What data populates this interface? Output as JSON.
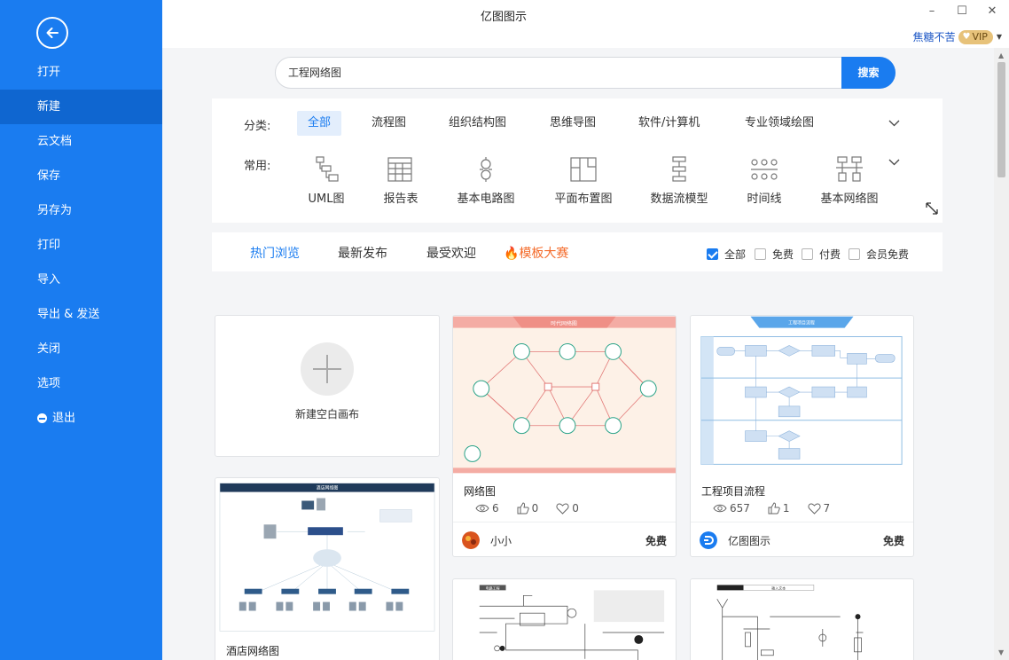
{
  "app": {
    "title": "亿图图示"
  },
  "window": {
    "minimize": "–",
    "maximize": "☐",
    "close": "✕"
  },
  "user": {
    "name": "焦糖不苦",
    "vip": "VIP"
  },
  "sidebar": {
    "items": [
      {
        "label": "打开"
      },
      {
        "label": "新建",
        "active": true
      },
      {
        "label": "云文档"
      },
      {
        "label": "保存"
      },
      {
        "label": "另存为"
      },
      {
        "label": "打印"
      },
      {
        "label": "导入"
      },
      {
        "label": "导出 & 发送"
      },
      {
        "label": "关闭"
      },
      {
        "label": "选项"
      },
      {
        "label": "退出"
      }
    ]
  },
  "search": {
    "value": "工程网络图",
    "button": "搜索"
  },
  "categories": {
    "label": "分类:",
    "items": [
      "全部",
      "流程图",
      "组织结构图",
      "思维导图",
      "软件/计算机",
      "专业领域绘图"
    ]
  },
  "common": {
    "label": "常用:",
    "items": [
      {
        "label": "UML图",
        "icon": "uml-icon"
      },
      {
        "label": "报告表",
        "icon": "report-icon"
      },
      {
        "label": "基本电路图",
        "icon": "circuit-icon"
      },
      {
        "label": "平面布置图",
        "icon": "floorplan-icon"
      },
      {
        "label": "数据流模型",
        "icon": "dataflow-icon"
      },
      {
        "label": "时间线",
        "icon": "timeline-icon"
      },
      {
        "label": "基本网络图",
        "icon": "network-icon"
      }
    ]
  },
  "tabs": {
    "items": [
      "热门浏览",
      "最新发布",
      "最受欢迎"
    ],
    "contest": "模板大赛"
  },
  "filters": [
    {
      "label": "全部",
      "checked": true
    },
    {
      "label": "免费",
      "checked": false
    },
    {
      "label": "付费",
      "checked": false
    },
    {
      "label": "会员免费",
      "checked": false
    }
  ],
  "new_blank": {
    "label": "新建空白画布"
  },
  "cards": [
    {
      "title": "网络图",
      "thumb_title": "时代网络图",
      "views": "6",
      "likes": "0",
      "favs": "0",
      "author": "小小",
      "price": "免费"
    },
    {
      "title": "工程项目流程",
      "thumb_title": "工程项目流程",
      "views": "657",
      "likes": "1",
      "favs": "7",
      "author": "亿图图示",
      "price": "免费"
    },
    {
      "title": "酒店网络图",
      "thumb_title": "酒店网络图"
    },
    {
      "title": "",
      "thumb_title": "电路工程"
    },
    {
      "title": "",
      "thumb_title": "插入文本"
    }
  ]
}
